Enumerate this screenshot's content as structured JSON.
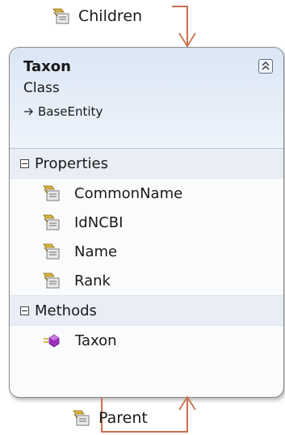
{
  "associations": {
    "children": {
      "label": "Children"
    },
    "parent": {
      "label": "Parent"
    }
  },
  "class_shape": {
    "name": "Taxon",
    "kind": "Class",
    "base_class": "BaseEntity",
    "properties_section": {
      "title": "Properties",
      "items": [
        "CommonName",
        "IdNCBI",
        "Name",
        "Rank"
      ]
    },
    "methods_section": {
      "title": "Methods",
      "items": [
        "Taxon"
      ]
    }
  },
  "icons": {
    "property": "property-icon",
    "method": "method-icon",
    "collapse": "collapse-chevron-icon",
    "section_toggle": "minus-box-icon"
  },
  "colors": {
    "association_line": "#c9704f",
    "header_gradient_top": "#dbe6f5",
    "section_background": "#e8edf6",
    "method_icon": "#9b2fbf"
  }
}
